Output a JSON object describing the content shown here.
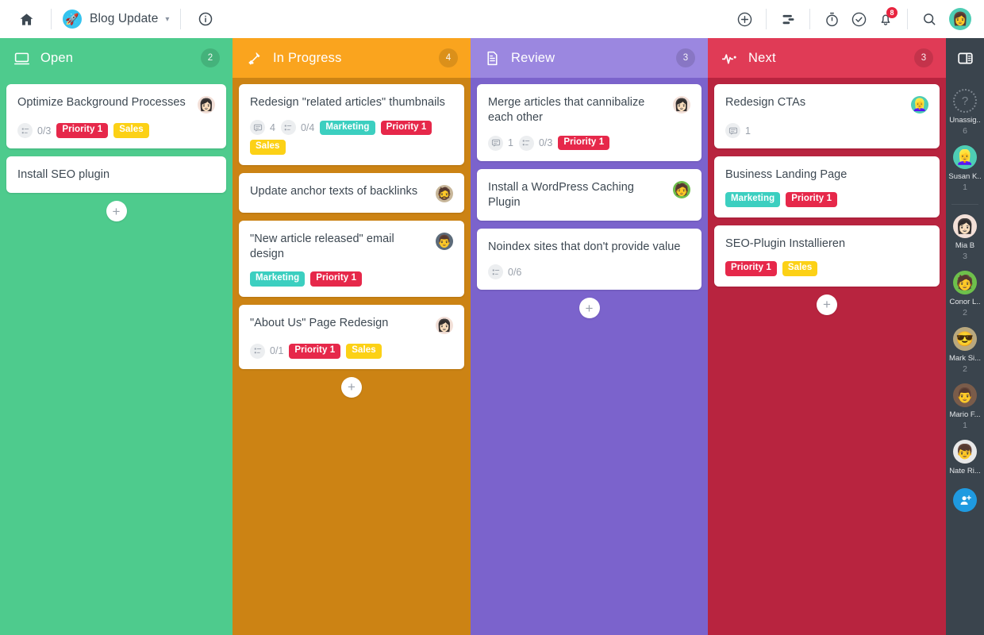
{
  "topbar": {
    "home_icon": "home-icon",
    "project": {
      "avatar_emoji": "🚀",
      "name": "Blog Update",
      "chevron": "▾"
    },
    "info_icon": "info-icon",
    "actions": [
      {
        "name": "add-button",
        "icon": "plus-circle-icon"
      },
      {
        "name": "filter-button",
        "icon": "filter-icon"
      },
      {
        "name": "timer-button",
        "icon": "stopwatch-icon"
      },
      {
        "name": "tasks-button",
        "icon": "check-circle-icon"
      },
      {
        "name": "notifications-button",
        "icon": "bell-icon",
        "badge": "8"
      },
      {
        "name": "search-button",
        "icon": "search-icon"
      }
    ],
    "user_avatar": "👩"
  },
  "colors": {
    "open_header": "#4ECB8D",
    "open_body": "#4ECB8D",
    "progress_header": "#FAA41E",
    "progress_body": "#CC8314",
    "review_header": "#9B87E0",
    "review_body": "#7B63CC",
    "next_header": "#E03B56",
    "next_body": "#B8243F",
    "rail": "#3A444D",
    "tag_priority": "#E6284A",
    "tag_sales": "#FCD116",
    "tag_marketing": "#3CCFC0"
  },
  "columns": [
    {
      "id": "open",
      "title": "Open",
      "count": "2",
      "icon": "monitor-icon",
      "header_color": "#4ECB8D",
      "body_color": "#4ECB8D",
      "add_label": "+",
      "cards": [
        {
          "title": "Optimize Background Processes",
          "avatar": "👩🏻",
          "avatar_bg": "#f3e0d8",
          "stats": [
            {
              "icon": "checklist-icon",
              "value": "0/3"
            }
          ],
          "tags": [
            {
              "label": "Priority 1",
              "color": "#E6284A",
              "text_color": "#ffffff"
            },
            {
              "label": "Sales",
              "color": "#FCD116",
              "text_color": "#ffffff"
            }
          ]
        },
        {
          "title": "Install SEO plugin",
          "avatar": "",
          "stats": [],
          "tags": []
        }
      ]
    },
    {
      "id": "in-progress",
      "title": "In Progress",
      "count": "4",
      "icon": "paint-roller-icon",
      "header_color": "#FAA41E",
      "body_color": "#CC8314",
      "add_label": "+",
      "cards": [
        {
          "title": "Redesign \"related articles\" thumbnails",
          "avatar": "",
          "stats": [
            {
              "icon": "comment-icon",
              "value": "4"
            },
            {
              "icon": "checklist-icon",
              "value": "0/4"
            }
          ],
          "tags": [
            {
              "label": "Marketing",
              "color": "#3CCFC0",
              "text_color": "#ffffff"
            },
            {
              "label": "Priority 1",
              "color": "#E6284A",
              "text_color": "#ffffff"
            },
            {
              "label": "Sales",
              "color": "#FCD116",
              "text_color": "#ffffff"
            }
          ]
        },
        {
          "title": "Update anchor texts of backlinks",
          "avatar": "🧔",
          "avatar_bg": "#c8b79a",
          "stats": [],
          "tags": []
        },
        {
          "title": "\"New article released\" email design",
          "avatar": "👨",
          "avatar_bg": "#5c6b7a",
          "stats": [],
          "tags": [
            {
              "label": "Marketing",
              "color": "#3CCFC0",
              "text_color": "#ffffff"
            },
            {
              "label": "Priority 1",
              "color": "#E6284A",
              "text_color": "#ffffff"
            }
          ]
        },
        {
          "title": "\"About Us\" Page Redesign",
          "avatar": "👩🏻",
          "avatar_bg": "#f3e0d8",
          "stats": [
            {
              "icon": "checklist-icon",
              "value": "0/1"
            }
          ],
          "tags": [
            {
              "label": "Priority 1",
              "color": "#E6284A",
              "text_color": "#ffffff"
            },
            {
              "label": "Sales",
              "color": "#FCD116",
              "text_color": "#ffffff"
            }
          ]
        }
      ]
    },
    {
      "id": "review",
      "title": "Review",
      "count": "3",
      "icon": "document-icon",
      "header_color": "#9B87E0",
      "body_color": "#7B63CC",
      "add_label": "+",
      "cards": [
        {
          "title": "Merge articles that cannibalize each other",
          "avatar": "👩🏻",
          "avatar_bg": "#f3e0d8",
          "stats": [
            {
              "icon": "comment-icon",
              "value": "1"
            },
            {
              "icon": "checklist-icon",
              "value": "0/3"
            }
          ],
          "tags": [
            {
              "label": "Priority 1",
              "color": "#E6284A",
              "text_color": "#ffffff"
            }
          ]
        },
        {
          "title": "Install a WordPress Caching Plugin",
          "avatar": "🧑",
          "avatar_bg": "#6ec04b",
          "stats": [],
          "tags": []
        },
        {
          "title": "Noindex sites that don't provide value",
          "avatar": "",
          "stats": [
            {
              "icon": "checklist-icon",
              "value": "0/6"
            }
          ],
          "tags": []
        }
      ]
    },
    {
      "id": "next",
      "title": "Next",
      "count": "3",
      "icon": "pulse-icon",
      "header_color": "#E03B56",
      "body_color": "#B8243F",
      "add_label": "+",
      "cards": [
        {
          "title": "Redesign CTAs",
          "avatar": "👱‍♀️",
          "avatar_bg": "#4ecdb4",
          "stats": [
            {
              "icon": "comment-icon",
              "value": "1"
            }
          ],
          "tags": []
        },
        {
          "title": "Business Landing Page",
          "avatar": "",
          "stats": [],
          "tags": [
            {
              "label": "Marketing",
              "color": "#3CCFC0",
              "text_color": "#ffffff"
            },
            {
              "label": "Priority 1",
              "color": "#E6284A",
              "text_color": "#ffffff"
            }
          ]
        },
        {
          "title": "SEO-Plugin Installieren",
          "avatar": "",
          "stats": [],
          "tags": [
            {
              "label": "Priority 1",
              "color": "#E6284A",
              "text_color": "#ffffff"
            },
            {
              "label": "Sales",
              "color": "#FCD116",
              "text_color": "#ffffff"
            }
          ]
        }
      ]
    }
  ],
  "rail": {
    "panel_icon": "sidebar-toggle-icon",
    "users": [
      {
        "name": "Unassig..",
        "count": "6",
        "avatar": "?",
        "unassigned": true,
        "divider_after": false
      },
      {
        "name": "Susan K..",
        "count": "1",
        "avatar": "👱‍♀️",
        "avatar_bg": "#4ecdb4",
        "divider_after": true
      },
      {
        "name": "Mia B",
        "count": "3",
        "avatar": "👩🏻",
        "avatar_bg": "#f3e0d8",
        "divider_after": false
      },
      {
        "name": "Conor L..",
        "count": "2",
        "avatar": "🧑",
        "avatar_bg": "#6ec04b",
        "divider_after": false
      },
      {
        "name": "Mark Si...",
        "count": "2",
        "avatar": "😎",
        "avatar_bg": "#b9a87e",
        "divider_after": false
      },
      {
        "name": "Mario F...",
        "count": "1",
        "avatar": "👨",
        "avatar_bg": "#7a5c4a",
        "divider_after": false
      },
      {
        "name": "Nate Ri...",
        "count": "",
        "avatar": "👦",
        "avatar_bg": "#e8e8e8",
        "divider_after": false
      }
    ],
    "add_user_label": "add-user-icon"
  }
}
